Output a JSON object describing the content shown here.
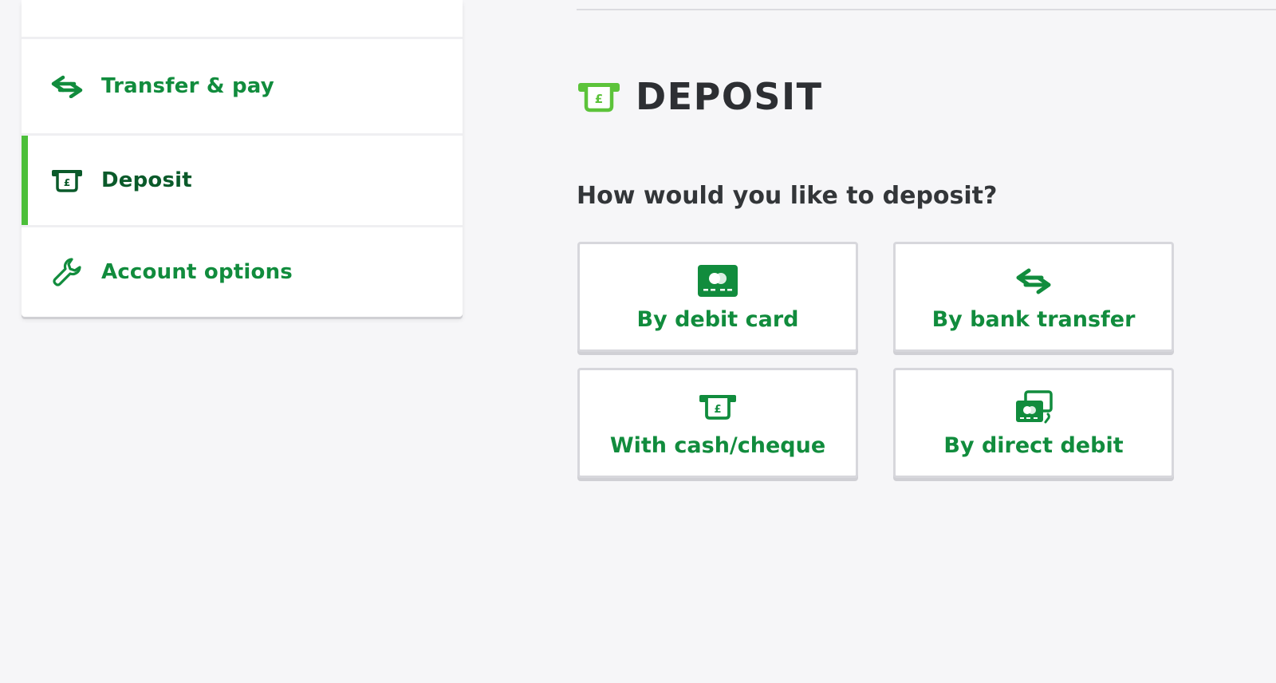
{
  "sidebar": {
    "items": [
      {
        "label": "Transfer & pay",
        "icon": "transfer-arrows-icon",
        "active": false
      },
      {
        "label": "Deposit",
        "icon": "deposit-cash-icon",
        "active": true
      },
      {
        "label": "Account options",
        "icon": "wrench-icon",
        "active": false
      }
    ]
  },
  "main": {
    "title": "DEPOSIT",
    "title_icon": "deposit-cash-icon",
    "question": "How would you like to deposit?",
    "options": [
      {
        "label": "By debit card",
        "icon": "debit-card-icon"
      },
      {
        "label": "By bank transfer",
        "icon": "transfer-arrows-icon"
      },
      {
        "label": "With cash/cheque",
        "icon": "deposit-cash-icon"
      },
      {
        "label": "By direct debit",
        "icon": "direct-debit-icon"
      }
    ]
  },
  "colors": {
    "brand_green": "#118c3d",
    "accent_green": "#4cbf3a",
    "dark_green": "#0a5a2a",
    "title_text": "#2d2f33",
    "background": "#f6f6f8"
  }
}
